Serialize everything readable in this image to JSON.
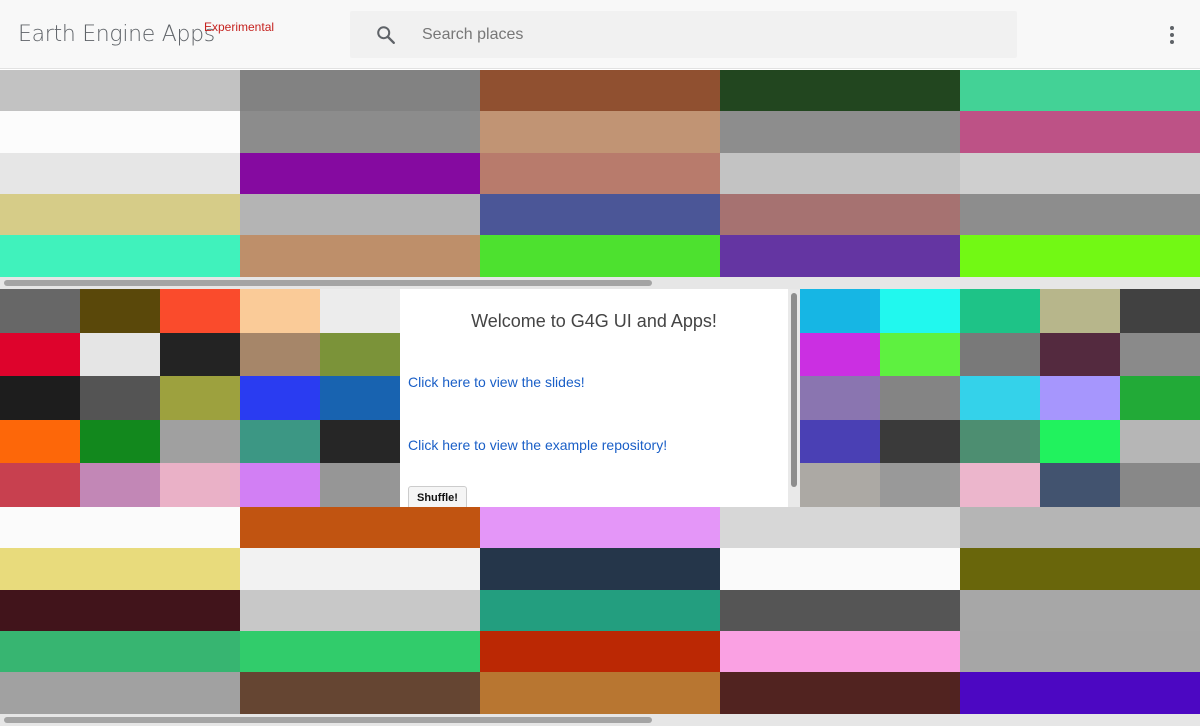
{
  "header": {
    "title": "Earth Engine Apps",
    "tag": "Experimental",
    "search_placeholder": "Search places",
    "search_icon": "search-icon",
    "menu_icon": "more-vert-icon"
  },
  "panel": {
    "title": "Welcome to G4G UI and Apps!",
    "slides_link": "Click here to view the slides!",
    "repo_link": "Click here to view the example repository!",
    "shuffle_label": "Shuffle!"
  },
  "palettes": {
    "top": [
      "#c2c2c2",
      "#828282",
      "#905030",
      "#22461f",
      "#43d296",
      "#fcfcfc",
      "#8c8c8c",
      "#c19474",
      "#8d8d8d",
      "#bd5286",
      "#e6e6e6",
      "#850aa0",
      "#b87b6c",
      "#c3c3c3",
      "#cfcfcf",
      "#d6cc88",
      "#b4b4b4",
      "#4b5697",
      "#a67271",
      "#8d8d8d",
      "#40f2bc",
      "#be8f6a",
      "#4de12f",
      "#6435a2",
      "#72f914"
    ],
    "left": [
      "#676767",
      "#5a480a",
      "#fa4b2c",
      "#facb98",
      "#ececec",
      "#de032c",
      "#e5e5e5",
      "#232323",
      "#a68669",
      "#7b9339",
      "#1d1d1d",
      "#545454",
      "#9da13e",
      "#2a3cf1",
      "#1863b0",
      "#fd6709",
      "#12881d",
      "#a0a0a0",
      "#3c9784",
      "#262626",
      "#c8404f",
      "#c287b6",
      "#eab1c7",
      "#d27ff4",
      "#969696"
    ],
    "right": [
      "#16b6e4",
      "#21f8ee",
      "#1ec387",
      "#b7b68b",
      "#414141",
      "#cb2fe2",
      "#5ef140",
      "#797979",
      "#542a3f",
      "#8a8a8a",
      "#8a75b0",
      "#848484",
      "#34d2ea",
      "#a696fd",
      "#22aa37",
      "#4a40b4",
      "#3a3a3a",
      "#4d8e71",
      "#21f25e",
      "#b6b6b6",
      "#aca9a4",
      "#999999",
      "#ecb6cc",
      "#42536f",
      "#888888"
    ],
    "bottom": [
      "#fbfbfb",
      "#c15411",
      "#e496f8",
      "#d7d7d7",
      "#b5b5b5",
      "#e8db7c",
      "#f2f2f2",
      "#25364a",
      "#fafafa",
      "#69660b",
      "#41141b",
      "#c8c8c8",
      "#239e7f",
      "#555555",
      "#a7a7a7",
      "#37b571",
      "#31cc6b",
      "#bb2804",
      "#faa1e3",
      "#a6a6a6",
      "#a1a1a1",
      "#654532",
      "#b87631",
      "#512320",
      "#4c07c2"
    ]
  }
}
